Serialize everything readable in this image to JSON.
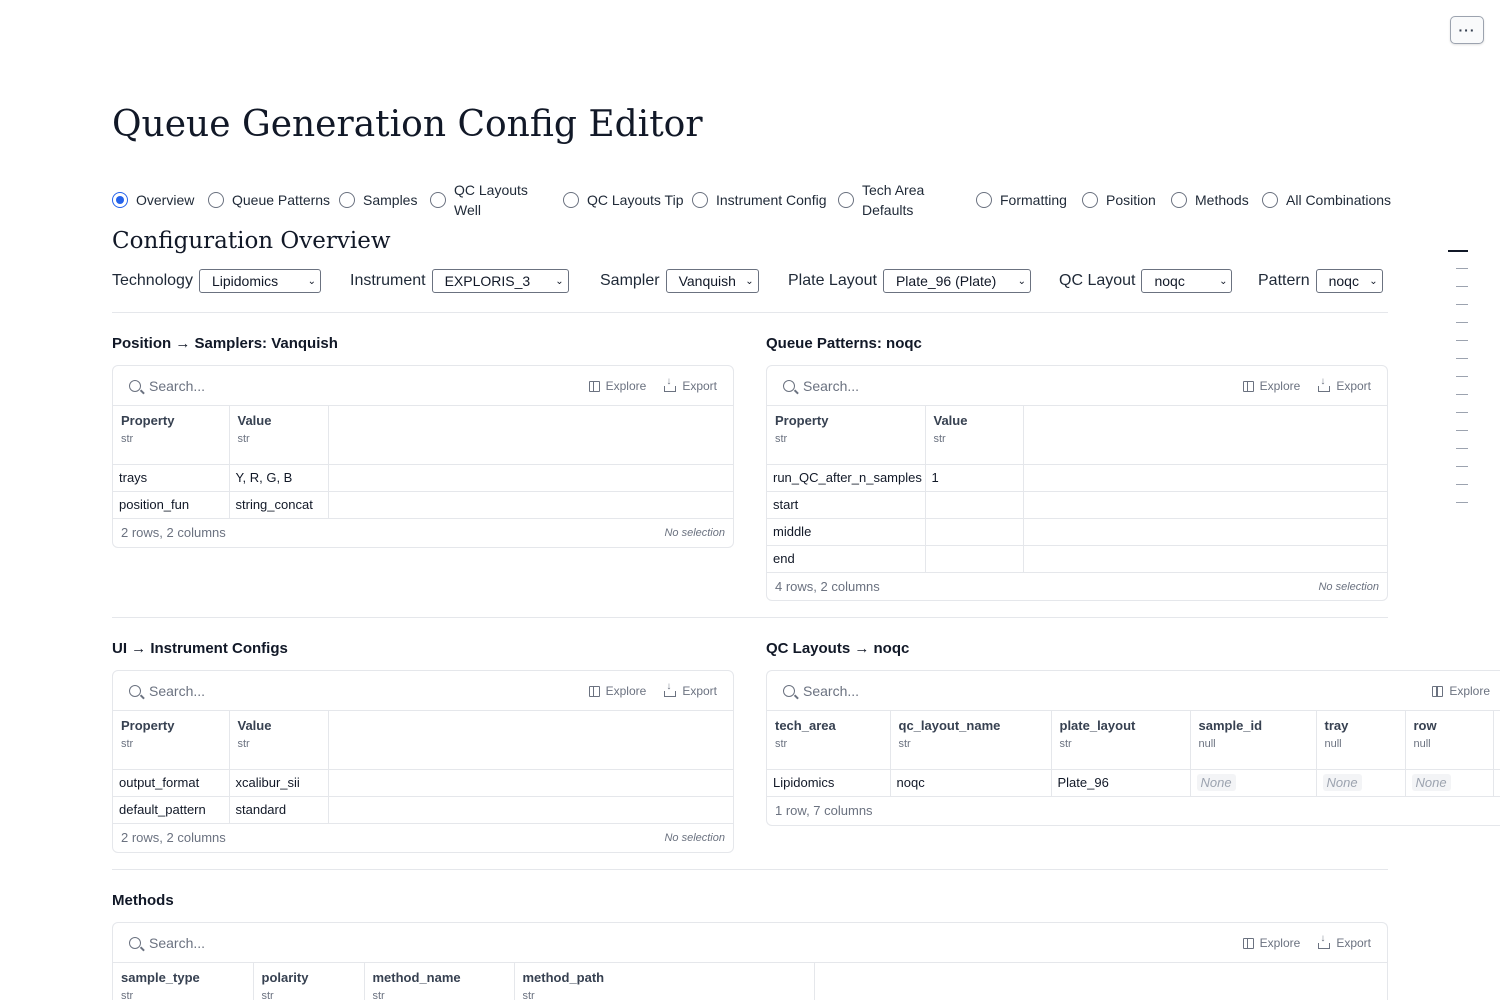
{
  "page": {
    "title": "Queue Generation Config Editor",
    "menu_label": "···"
  },
  "tabs": [
    {
      "label": "Overview",
      "checked": true
    },
    {
      "label": "Queue Patterns",
      "checked": false
    },
    {
      "label": "Samples",
      "checked": false
    },
    {
      "label": "QC Layouts Well",
      "checked": false
    },
    {
      "label": "QC Layouts Tip",
      "checked": false
    },
    {
      "label": "Instrument Config",
      "checked": false
    },
    {
      "label": "Tech Area Defaults",
      "checked": false
    },
    {
      "label": "Formatting",
      "checked": false
    },
    {
      "label": "Position",
      "checked": false
    },
    {
      "label": "Methods",
      "checked": false
    },
    {
      "label": "All Combinations",
      "checked": false
    }
  ],
  "overview": {
    "title": "Configuration Overview",
    "filters": [
      {
        "label": "Technology",
        "value": "Lipidomics"
      },
      {
        "label": "Instrument",
        "value": "EXPLORIS_3"
      },
      {
        "label": "Sampler",
        "value": "Vanquish"
      },
      {
        "label": "Plate Layout",
        "value": "Plate_96 (Plate)"
      },
      {
        "label": "QC Layout",
        "value": "noqc"
      },
      {
        "label": "Pattern",
        "value": "noqc"
      }
    ]
  },
  "common": {
    "search_placeholder": "Search...",
    "explore": "Explore",
    "export": "Export",
    "no_selection": "No selection",
    "null_value": "None"
  },
  "position_panel": {
    "title": "Position → Samplers: Vanquish",
    "columns": [
      {
        "name": "Property",
        "type": "str"
      },
      {
        "name": "Value",
        "type": "str"
      }
    ],
    "rows": [
      [
        "trays",
        "Y, R, G, B"
      ],
      [
        "position_fun",
        "string_concat"
      ]
    ],
    "footer": "2 rows, 2 columns"
  },
  "queue_panel": {
    "title": "Queue Patterns: noqc",
    "columns": [
      {
        "name": "Property",
        "type": "str"
      },
      {
        "name": "Value",
        "type": "str"
      }
    ],
    "rows": [
      [
        "run_QC_after_n_samples",
        "1"
      ],
      [
        "start",
        ""
      ],
      [
        "middle",
        ""
      ],
      [
        "end",
        ""
      ]
    ],
    "footer": "4 rows, 2 columns"
  },
  "ui_panel": {
    "title": "UI → Instrument Configs",
    "columns": [
      {
        "name": "Property",
        "type": "str"
      },
      {
        "name": "Value",
        "type": "str"
      }
    ],
    "rows": [
      [
        "output_format",
        "xcalibur_sii"
      ],
      [
        "default_pattern",
        "standard"
      ]
    ],
    "footer": "2 rows, 2 columns"
  },
  "qc_panel": {
    "title": "QC Layouts → noqc",
    "columns": [
      {
        "name": "tech_area",
        "type": "str"
      },
      {
        "name": "qc_layout_name",
        "type": "str"
      },
      {
        "name": "plate_layout",
        "type": "str"
      },
      {
        "name": "sample_id",
        "type": "null"
      },
      {
        "name": "tray",
        "type": "null"
      },
      {
        "name": "row",
        "type": "null"
      }
    ],
    "rows": [
      [
        "Lipidomics",
        "noqc",
        "Plate_96",
        null,
        null,
        null
      ]
    ],
    "footer": "1 row, 7 columns"
  },
  "methods_panel": {
    "title": "Methods",
    "columns": [
      {
        "name": "sample_type",
        "type": "str"
      },
      {
        "name": "polarity",
        "type": "str"
      },
      {
        "name": "method_name",
        "type": "str"
      },
      {
        "name": "method_path",
        "type": "str"
      }
    ]
  }
}
